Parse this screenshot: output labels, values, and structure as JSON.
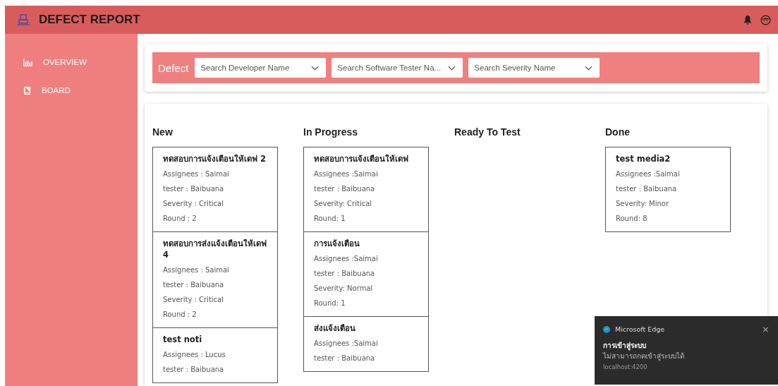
{
  "header": {
    "title": "DEFECT REPORT"
  },
  "sidebar": {
    "items": [
      {
        "label": "OVERVIEW",
        "kind": "chart",
        "selected": false
      },
      {
        "label": "BOARD",
        "kind": "book",
        "selected": false
      }
    ]
  },
  "filter": {
    "label": "Defect",
    "dropdowns": [
      {
        "placeholder": "Search Developer Name"
      },
      {
        "placeholder": "Search Software Tester Na..."
      },
      {
        "placeholder": "Search Severity Name"
      }
    ]
  },
  "board": {
    "columns": [
      {
        "title": "New",
        "cards": [
          {
            "title": "ทดสอบการแจ้งเตือนให้เดฟ 2",
            "fields": [
              "Assignees : Saimai",
              "tester : Baibuana",
              "Severity : Critical",
              "Round : 2"
            ]
          },
          {
            "title": "ทดสอบการส่งแจ้งเตือนให้เดฟ 4",
            "fields": [
              "Assignees : Saimai",
              "tester : Baibuana",
              "Severity : Critical",
              "Round : 2"
            ]
          },
          {
            "title": "test noti",
            "fields": [
              "Assignees : Lucus",
              "tester : Baibuana"
            ]
          }
        ]
      },
      {
        "title": "In Progress",
        "cards": [
          {
            "title": "ทดสอบการแจ้งเตือนให้เดฟ",
            "fields": [
              "Assignees :Saimai",
              "tester : Baibuana",
              "Severity: Critical",
              "Round: 1"
            ]
          },
          {
            "title": "การแจ้งเตือน",
            "fields": [
              "Assignees :Saimai",
              "tester : Baibuana",
              "Severity: Normal",
              "Round: 1"
            ]
          },
          {
            "title": "ส่งแจ้งเตือน",
            "fields": [
              "Assignees :Saimai",
              "tester : Baibuana"
            ]
          }
        ]
      },
      {
        "title": "Ready To Test"
      },
      {
        "title": "Done",
        "cards": [
          {
            "title": "test media2",
            "fields": [
              "Assignees :Saimai",
              "tester : Baibuana",
              "Severity: Minor",
              "Round: 8"
            ]
          }
        ]
      }
    ]
  },
  "notification": {
    "app": "Microsoft Edge",
    "close": "×",
    "title": "การเข้าสู่ระบบ",
    "message": "ไม่สามารถกดเข้าสู่ระบบได้",
    "source": "localhost:4200"
  }
}
